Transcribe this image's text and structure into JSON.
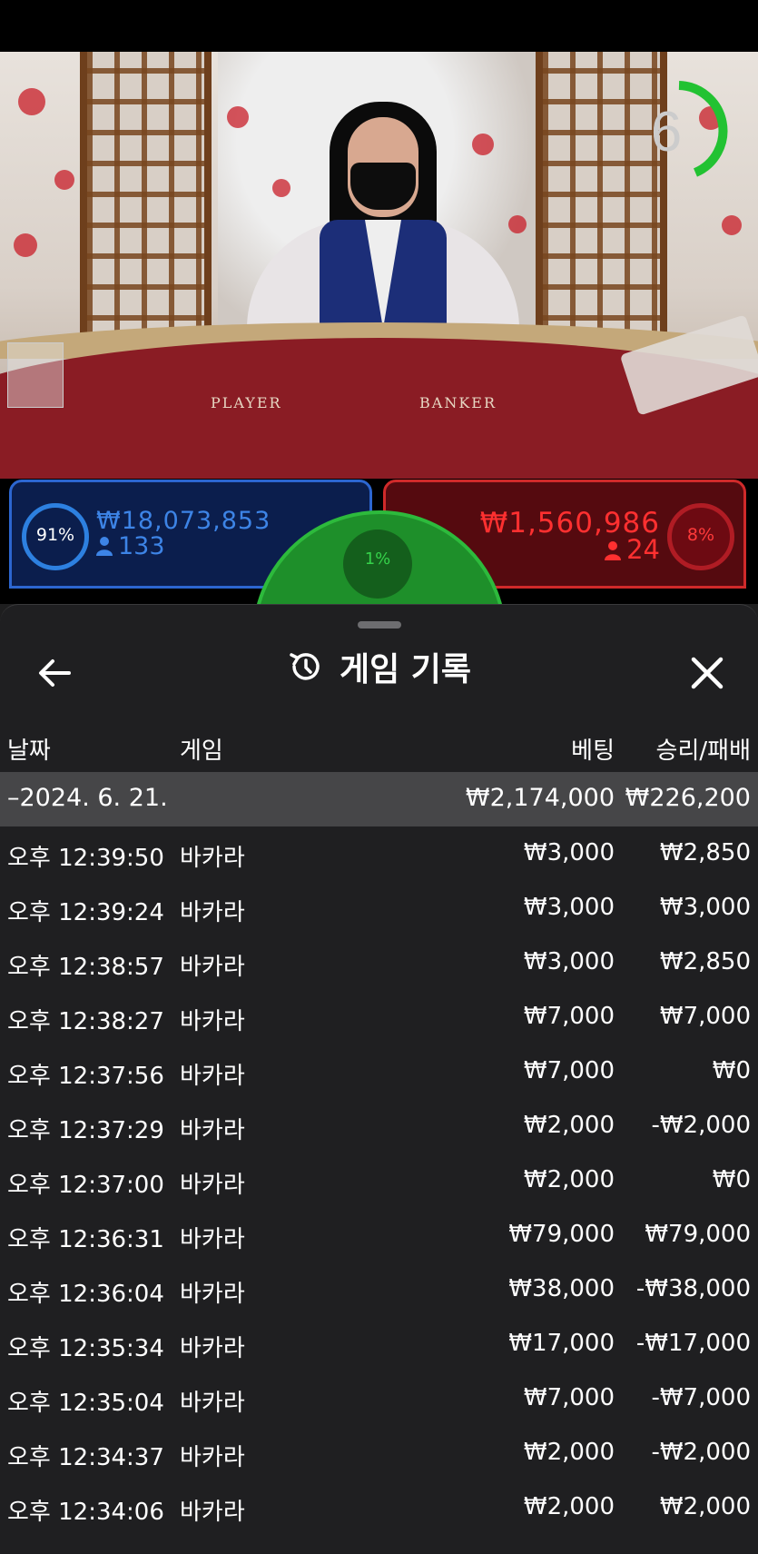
{
  "live": {
    "timer": "6",
    "felt_player_label": "PLAYER",
    "felt_banker_label": "BANKER",
    "player": {
      "percent": "91%",
      "amount": "₩18,073,853",
      "count": "133",
      "color": "#2c66d0"
    },
    "tie": {
      "percent": "1%",
      "color": "#1e8f2a"
    },
    "banker": {
      "percent": "8%",
      "amount": "₩1,560,986",
      "count": "24",
      "color": "#d02a2a"
    }
  },
  "sheet": {
    "title": "게임 기록",
    "back_icon": "arrow-left-icon",
    "close_icon": "close-icon",
    "title_icon": "history-icon",
    "columns": {
      "date": "날짜",
      "game": "게임",
      "bet": "베팅",
      "win_loss": "승리/패배"
    },
    "day": {
      "date": "–2024. 6. 21.",
      "bet_total": "₩2,174,000",
      "win_total": "₩226,200"
    },
    "rows": [
      {
        "time": "오후 12:39:50",
        "game": "바카라",
        "bet": "₩3,000",
        "result": "₩2,850"
      },
      {
        "time": "오후 12:39:24",
        "game": "바카라",
        "bet": "₩3,000",
        "result": "₩3,000"
      },
      {
        "time": "오후 12:38:57",
        "game": "바카라",
        "bet": "₩3,000",
        "result": "₩2,850"
      },
      {
        "time": "오후 12:38:27",
        "game": "바카라",
        "bet": "₩7,000",
        "result": "₩7,000"
      },
      {
        "time": "오후 12:37:56",
        "game": "바카라",
        "bet": "₩7,000",
        "result": "₩0"
      },
      {
        "time": "오후 12:37:29",
        "game": "바카라",
        "bet": "₩2,000",
        "result": "-₩2,000"
      },
      {
        "time": "오후 12:37:00",
        "game": "바카라",
        "bet": "₩2,000",
        "result": "₩0"
      },
      {
        "time": "오후 12:36:31",
        "game": "바카라",
        "bet": "₩79,000",
        "result": "₩79,000"
      },
      {
        "time": "오후 12:36:04",
        "game": "바카라",
        "bet": "₩38,000",
        "result": "-₩38,000"
      },
      {
        "time": "오후 12:35:34",
        "game": "바카라",
        "bet": "₩17,000",
        "result": "-₩17,000"
      },
      {
        "time": "오후 12:35:04",
        "game": "바카라",
        "bet": "₩7,000",
        "result": "-₩7,000"
      },
      {
        "time": "오후 12:34:37",
        "game": "바카라",
        "bet": "₩2,000",
        "result": "-₩2,000"
      },
      {
        "time": "오후 12:34:06",
        "game": "바카라",
        "bet": "₩2,000",
        "result": "₩2,000"
      }
    ]
  }
}
